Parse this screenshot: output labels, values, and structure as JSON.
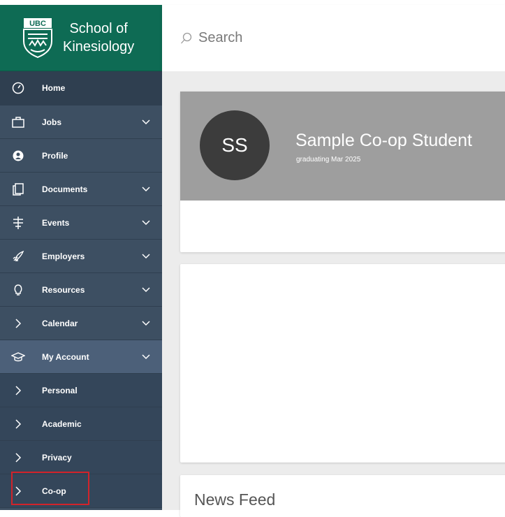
{
  "school": {
    "line1": "School of",
    "line2": "Kinesiology",
    "crest_label": "UBC"
  },
  "search": {
    "placeholder": "Search"
  },
  "nav": {
    "home": "Home",
    "jobs": "Jobs",
    "profile": "Profile",
    "documents": "Documents",
    "events": "Events",
    "employers": "Employers",
    "resources": "Resources",
    "calendar": "Calendar",
    "my_account": "My Account",
    "personal": "Personal",
    "academic": "Academic",
    "privacy": "Privacy",
    "coop": "Co-op"
  },
  "profile": {
    "initials": "SS",
    "name": "Sample Co-op Student",
    "subtitle": "graduating Mar 2025"
  },
  "news": {
    "title": "News Feed"
  },
  "colors": {
    "sidebar": "#3d4f62",
    "logo_bg": "#0e6b54",
    "highlight": "#d2232a",
    "banner": "#9e9e9e"
  }
}
